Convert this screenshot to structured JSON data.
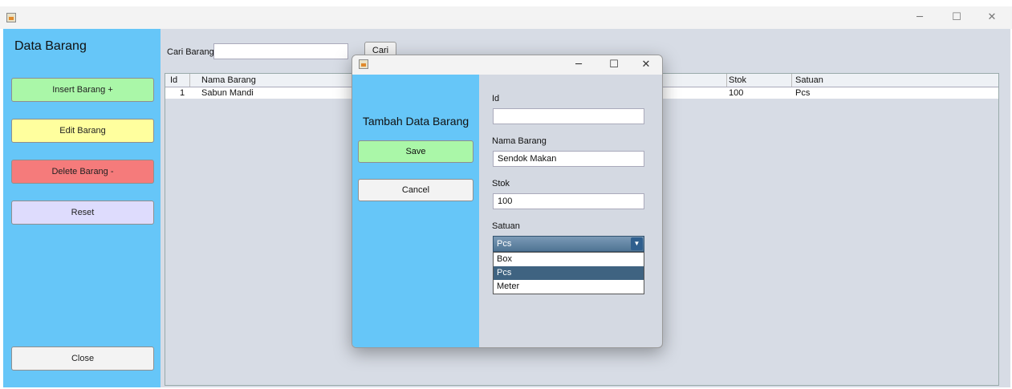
{
  "main": {
    "sidebar": {
      "title": "Data Barang",
      "buttons": {
        "insert": "Insert Barang +",
        "edit": "Edit Barang",
        "delete": "Delete Barang -",
        "reset": "Reset",
        "close": "Close"
      },
      "colors": {
        "panel": "#66c6f8",
        "insert": "#aaf7a8",
        "edit": "#ffff9e",
        "delete": "#f57b7b",
        "reset": "#dedcfd",
        "close": "#f3f3f3"
      }
    },
    "search": {
      "label": "Cari Barang",
      "value": "",
      "button": "Cari"
    },
    "table": {
      "columns": [
        "Id",
        "Nama Barang",
        "Stok",
        "Satuan"
      ],
      "rows": [
        {
          "id": "1",
          "nama": "Sabun Mandi",
          "stok": "100",
          "satuan": "Pcs"
        }
      ]
    }
  },
  "dialog": {
    "heading": "Tambah Data Barang",
    "save": "Save",
    "cancel": "Cancel",
    "fields": {
      "id_label": "Id",
      "id_value": "",
      "nama_label": "Nama Barang",
      "nama_value": "Sendok Makan",
      "stok_label": "Stok",
      "stok_value": "100",
      "satuan_label": "Satuan",
      "satuan_value": "Pcs"
    },
    "satuan_options": [
      "Box",
      "Pcs",
      "Meter"
    ],
    "selected_option": "Pcs"
  },
  "window_controls": {
    "minimize": "─",
    "maximize": "☐",
    "close": "✕"
  },
  "icons": {
    "app": "java-app-icon",
    "dropdown": "chevron-down-icon"
  }
}
